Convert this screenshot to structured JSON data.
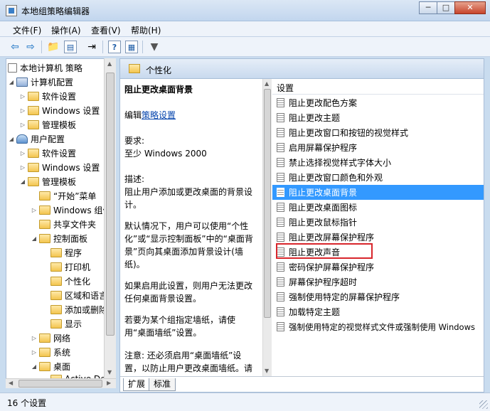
{
  "window": {
    "title": "本地组策略编辑器",
    "controls": {
      "minimize": "─",
      "maximize": "□",
      "close": "✕"
    }
  },
  "menu": [
    "文件(F)",
    "操作(A)",
    "查看(V)",
    "帮助(H)"
  ],
  "toolbar_icons": [
    "back-arrow-icon",
    "forward-arrow-icon",
    "folder-up-icon",
    "show-hide-tree-icon",
    "export-list-icon",
    "help-icon",
    "properties-icon",
    "filter-icon"
  ],
  "tree": {
    "root": "本地计算机 策略",
    "items": [
      "计算机配置",
      "软件设置",
      "Windows 设置",
      "管理模板",
      "用户配置",
      "软件设置",
      "Windows 设置",
      "管理模板",
      "“开始”菜单",
      "Windows 组件",
      "共享文件夹",
      "控制面板",
      "程序",
      "打印机",
      "个性化",
      "区域和语言",
      "添加或删除",
      "显示",
      "网络",
      "系统",
      "桌面",
      "Active Desktop"
    ]
  },
  "header": {
    "title": "个性化"
  },
  "description": {
    "title": "阻止更改桌面背景",
    "edit_prefix": "编辑",
    "edit_link": "策略设置",
    "req_label": "要求:",
    "req_value": "至少 Windows 2000",
    "desc_label": "描述:",
    "p1": "阻止用户添加或更改桌面的背景设计。",
    "p2": "默认情况下，用户可以使用“个性化”或“显示控制面板”中的“桌面背景”页向其桌面添加背景设计(墙纸)。",
    "p3": "如果启用此设置，则用户无法更改任何桌面背景设置。",
    "p4": "若要为某个组指定墙纸，请使用“桌面墙纸”设置。",
    "p5": "注意: 还必须启用“桌面墙纸”设置，以防止用户更改桌面墙纸。请"
  },
  "list": {
    "column": "设置",
    "selected_index": 6,
    "items": [
      "阻止更改配色方案",
      "阻止更改主题",
      "阻止更改窗口和按钮的视觉样式",
      "启用屏幕保护程序",
      "禁止选择视觉样式字体大小",
      "阻止更改窗口颜色和外观",
      "阻止更改桌面背景",
      "阻止更改桌面图标",
      "阻止更改鼠标指针",
      "阻止更改屏幕保护程序",
      "阻止更改声音",
      "密码保护屏幕保护程序",
      "屏幕保护程序超时",
      "强制使用特定的屏幕保护程序",
      "加载特定主题",
      "强制使用特定的视觉样式文件或强制使用 Windows"
    ]
  },
  "tabs": {
    "extended": "扩展",
    "standard": "标准"
  },
  "status": {
    "text": "16 个设置"
  },
  "colors": {
    "selection": "#3399ff",
    "highlight_box": "#d8262c",
    "link": "#0645ad"
  }
}
